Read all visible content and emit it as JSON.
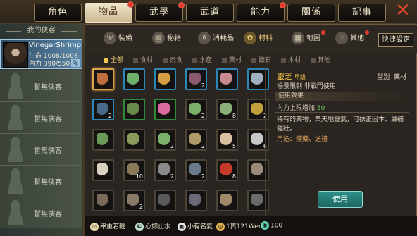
{
  "tabs": [
    {
      "label": "角色",
      "dot": false
    },
    {
      "label": "物品",
      "dot": true
    },
    {
      "label": "武學",
      "dot": true
    },
    {
      "label": "武道",
      "dot": false
    },
    {
      "label": "能力",
      "dot": true
    },
    {
      "label": "關係",
      "dot": false
    },
    {
      "label": "記事",
      "dot": false
    }
  ],
  "active_tab": "物品",
  "left": {
    "title": "我的俠客",
    "member": {
      "name": "VinegarShrimp",
      "hp": "生命 1008/1008",
      "mp": "內力 390/550",
      "tag": "隊"
    },
    "empty_label": "暫無俠客"
  },
  "categories": [
    {
      "label": "裝備",
      "icon": "armor-icon",
      "dot": false
    },
    {
      "label": "秘籍",
      "icon": "book-icon",
      "dot": false
    },
    {
      "label": "消耗品",
      "icon": "potion-icon",
      "dot": false
    },
    {
      "label": "材料",
      "icon": "herb-icon",
      "dot": false
    },
    {
      "label": "地圖",
      "icon": "map-icon",
      "dot": true
    },
    {
      "label": "其他",
      "icon": "misc-icon",
      "dot": true
    }
  ],
  "active_category": "材料",
  "shortcut_label": "快捷設定",
  "filters": [
    "全部",
    "食材",
    "肉食",
    "水產",
    "藥材",
    "礦石",
    "木材",
    "其他"
  ],
  "active_filter": "全部",
  "grid_rows": [
    [
      {
        "c": "#c0703e",
        "b": "sel",
        "q": ""
      },
      {
        "c": "#6fb06a",
        "b": "blue",
        "q": ""
      },
      {
        "c": "#d4a043",
        "b": "blue",
        "q": ""
      },
      {
        "c": "#8a5a6e",
        "b": "blue",
        "q": "2"
      },
      {
        "c": "#c88a8e",
        "b": "blue",
        "q": ""
      },
      {
        "c": "#9fb0c0",
        "b": "blue",
        "q": ""
      }
    ],
    [
      {
        "c": "#4a6a8a",
        "b": "blue",
        "q": "2"
      },
      {
        "c": "#6a8a4a",
        "b": "green",
        "q": ""
      },
      {
        "c": "#d86aa0",
        "b": "green",
        "q": ""
      },
      {
        "c": "#7ab06a",
        "b": "",
        "q": "2"
      },
      {
        "c": "#8ab07a",
        "b": "",
        "q": "8"
      },
      {
        "c": "#c0a03a",
        "b": "",
        "q": "2"
      }
    ],
    [
      {
        "c": "#6a9a5a",
        "b": "",
        "q": ""
      },
      {
        "c": "#8a9a5a",
        "b": "",
        "q": ""
      },
      {
        "c": "#7ab06a",
        "b": "",
        "q": "2"
      },
      {
        "c": "#b09a6a",
        "b": "",
        "q": "2"
      },
      {
        "c": "#d8c0a0",
        "b": "",
        "q": "5"
      },
      {
        "c": "#c8c8c8",
        "b": "",
        "q": "6"
      }
    ],
    [
      {
        "c": "#d8d0c0",
        "b": "",
        "q": ""
      },
      {
        "c": "#8a7a5a",
        "b": "",
        "q": "10"
      },
      {
        "c": "#8a8a8a",
        "b": "",
        "q": "2"
      },
      {
        "c": "#6a7a8a",
        "b": "",
        "q": "2"
      },
      {
        "c": "#c83a2a",
        "b": "",
        "q": "8"
      },
      {
        "c": "#9a8a7a",
        "b": "",
        "q": ""
      }
    ],
    [
      {
        "c": "#7a6a5a",
        "b": "",
        "q": ""
      },
      {
        "c": "#8a7a6a",
        "b": "",
        "q": "2"
      },
      {
        "c": "#5a5a5a",
        "b": "",
        "q": ""
      },
      {
        "c": "#6a6a7a",
        "b": "",
        "q": ""
      },
      {
        "c": "#a08a6a",
        "b": "",
        "q": ""
      },
      {
        "c": "#6a6a6a",
        "b": "",
        "q": ""
      }
    ]
  ],
  "detail": {
    "name": "靈芝",
    "grade": "甲級",
    "type_label": "型別",
    "type_value": "藥材",
    "limit": "場景限制  非戰鬥使用",
    "effect_title": "使用效果",
    "effect": "內力上限增加",
    "effect_value": "50",
    "desc": "稀有的藥物，集天地靈氣，可扶正固本、滋補強壯。",
    "use": "用途：煉藥、送禮",
    "button": "使用"
  },
  "status": [
    {
      "icon": "weight-icon",
      "text": "舉重若輕"
    },
    {
      "icon": "calm-icon",
      "text": "心如止水"
    },
    {
      "icon": "fame-icon",
      "text": "小有名氣"
    },
    {
      "icon": "money-icon",
      "text": "1貫121Wen"
    },
    {
      "icon": "coin-icon",
      "text": "100"
    }
  ]
}
